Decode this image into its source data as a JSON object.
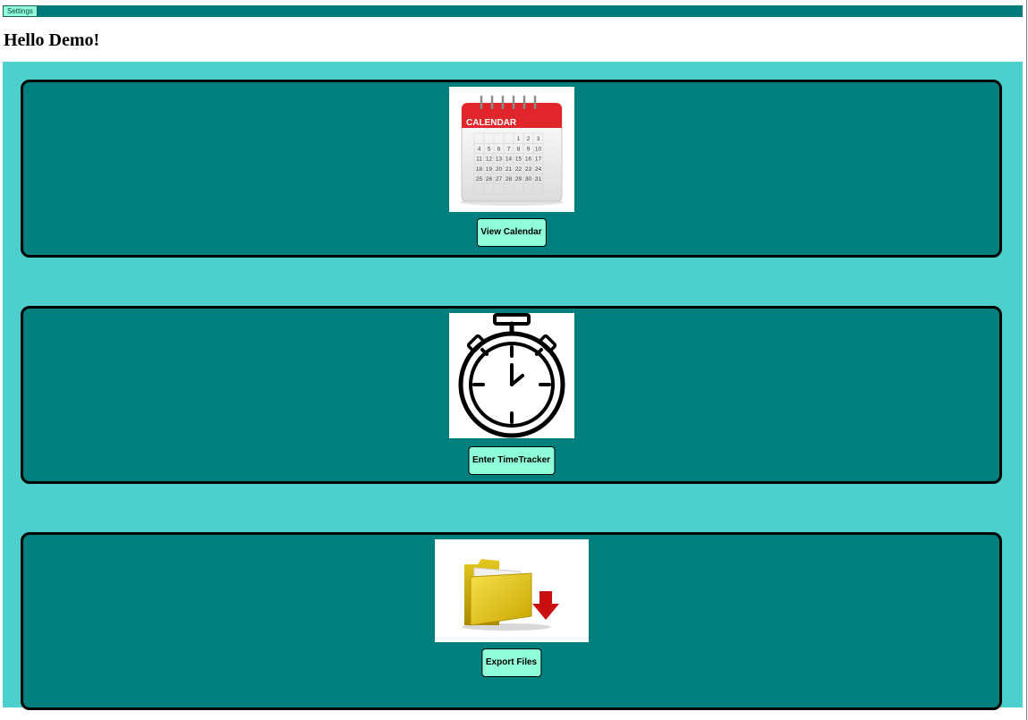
{
  "topbar": {
    "settings_label": "Settings"
  },
  "greeting": "Hello Demo!",
  "cards": [
    {
      "image": "calendar-icon",
      "image_text": "CALENDAR",
      "button_label": "View Calendar"
    },
    {
      "image": "stopwatch-icon",
      "button_label": "Enter TimeTracker"
    },
    {
      "image": "folder-download-icon",
      "button_label": "Export Files"
    }
  ],
  "calendar_days": [
    "1",
    "2",
    "3",
    "4",
    "5",
    "6",
    "7",
    "8",
    "9",
    "10",
    "11",
    "12",
    "13",
    "14",
    "15",
    "16",
    "17",
    "18",
    "19",
    "20",
    "21",
    "22",
    "23",
    "24",
    "25",
    "26",
    "27",
    "28",
    "29",
    "30",
    "31"
  ],
  "colors": {
    "topbar": "#007b7b",
    "main_bg": "#4dd0cd",
    "card_bg": "#007f7f",
    "button_bg": "#8fffd9"
  }
}
